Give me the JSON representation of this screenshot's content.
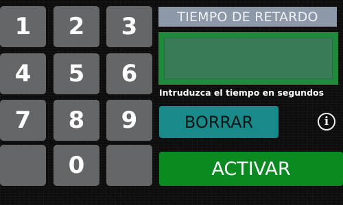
{
  "keypad": {
    "keys": [
      "1",
      "2",
      "3",
      "4",
      "5",
      "6",
      "7",
      "8",
      "9",
      "",
      "0",
      ""
    ]
  },
  "header": {
    "title": "TIEMPO DE RETARDO"
  },
  "delay_input": {
    "value": "",
    "hint": "Intruduzca el tiempo en segundos"
  },
  "actions": {
    "clear_label": "BORRAR",
    "activate_label": "ACTIVAR",
    "info_icon": "info-icon",
    "info_glyph": "i"
  },
  "colors": {
    "key_bg": "#656667",
    "title_bg": "#8d99a8",
    "input_frame": "#1e8a3c",
    "clear_bg": "#198a8a",
    "activate_bg": "#0b8a22"
  }
}
